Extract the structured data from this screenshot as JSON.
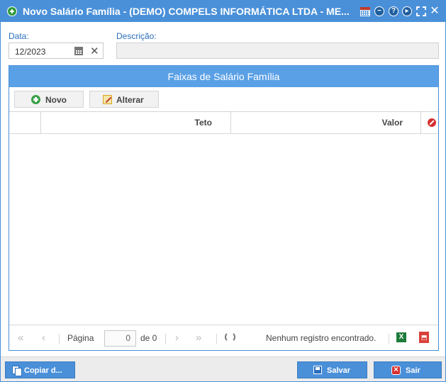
{
  "window": {
    "title": "Novo Salário Família - (DEMO) COMPELS INFORMÁTICA LTDA - ME..."
  },
  "form": {
    "data_label": "Data:",
    "data_value": "12/2023",
    "descricao_label": "Descrição:",
    "descricao_value": ""
  },
  "grid": {
    "title": "Faixas de Salário Família",
    "toolbar": {
      "novo_label": "Novo",
      "alterar_label": "Alterar"
    },
    "columns": [
      "Teto",
      "Valor"
    ],
    "rows": [],
    "pager": {
      "page_label": "Página",
      "page_value": "0",
      "of_label": "de 0",
      "status": "Nenhum registro encontrado."
    }
  },
  "footer": {
    "copy_label": "Copiar d...",
    "save_label": "Salvar",
    "exit_label": "Sair"
  },
  "colors": {
    "accent": "#4a90d9",
    "panel_header": "#5aa0e6",
    "label_blue": "#2a6ebd"
  },
  "icons": {
    "title": "add-green-icon",
    "toolbar": [
      "calendar-icon",
      "minimize-icon",
      "help-icon",
      "play-icon",
      "maximize-icon",
      "close-icon"
    ]
  }
}
